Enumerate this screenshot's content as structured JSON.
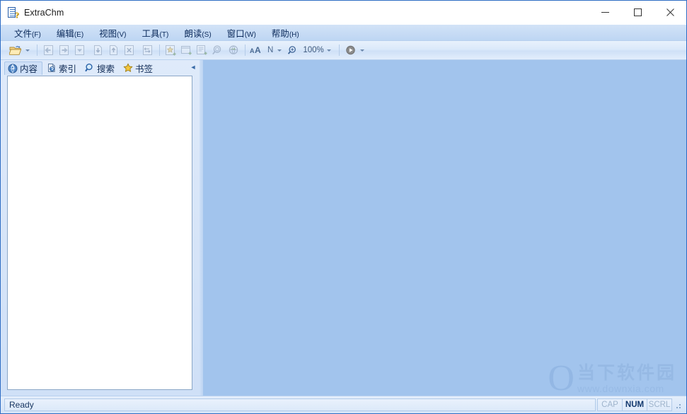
{
  "window": {
    "title": "ExtraChm",
    "app_icon": "chm-help-document-icon",
    "border_color": "#2e6dc4",
    "controls": [
      {
        "name": "minimize",
        "glyph": "minimize-icon"
      },
      {
        "name": "maximize",
        "glyph": "maximize-icon"
      },
      {
        "name": "close",
        "glyph": "close-icon"
      }
    ]
  },
  "menubar": {
    "items": [
      {
        "label": "文件",
        "mnemonic": "(F)"
      },
      {
        "label": "编辑",
        "mnemonic": "(E)"
      },
      {
        "label": "视图",
        "mnemonic": "(V)"
      },
      {
        "label": "工具",
        "mnemonic": "(T)"
      },
      {
        "label": "朗读",
        "mnemonic": "(S)"
      },
      {
        "label": "窗口",
        "mnemonic": "(W)"
      },
      {
        "label": "帮助",
        "mnemonic": "(H)"
      }
    ]
  },
  "toolbar": {
    "open_icon": "open-folder-icon",
    "back_icon": "back-arrow-icon",
    "forward_icon": "forward-arrow-icon",
    "home_icon": "down-chevron-page-icon",
    "prev_page_icon": "page-down-icon",
    "next_page_icon": "page-up-icon",
    "stop_icon": "stop-page-icon",
    "refresh_icon": "refresh-page-icon",
    "add_favorite_icon": "add-favorite-page-icon",
    "new_window_icon": "new-window-icon",
    "add_note_icon": "add-note-icon",
    "find_icon": "find-magnifier-icon",
    "translate_icon": "translate-globe-icon",
    "font_icon": "font-size-icon",
    "font_style_label": "N",
    "zoom_icon": "zoom-magnifier-icon",
    "zoom_label": "100%",
    "play_icon": "play-read-aloud-icon",
    "dropdown_icon": "chevron-down-icon"
  },
  "left_pane": {
    "tabs": [
      {
        "label": "内容",
        "icon": "contents-book-icon",
        "active": true
      },
      {
        "label": "索引",
        "icon": "index-key-icon",
        "active": false
      },
      {
        "label": "搜索",
        "icon": "search-magnifier-icon",
        "active": false
      },
      {
        "label": "书签",
        "icon": "bookmark-star-icon",
        "active": false
      }
    ],
    "collapse_icon": "collapse-left-arrow-icon",
    "collapse_glyph": "◄",
    "tree": {
      "items": []
    }
  },
  "content": {
    "background_color": "#a2c4ed",
    "document": ""
  },
  "watermark": {
    "logo_glyph": "O",
    "brand": "当下软件园",
    "url": "www.downxia.com"
  },
  "statusbar": {
    "message": "Ready",
    "indicators": [
      {
        "label": "CAP",
        "active": false
      },
      {
        "label": "NUM",
        "active": true
      },
      {
        "label": "SCRL",
        "active": false
      }
    ],
    "resize_grip": "resize-grip-icon"
  }
}
